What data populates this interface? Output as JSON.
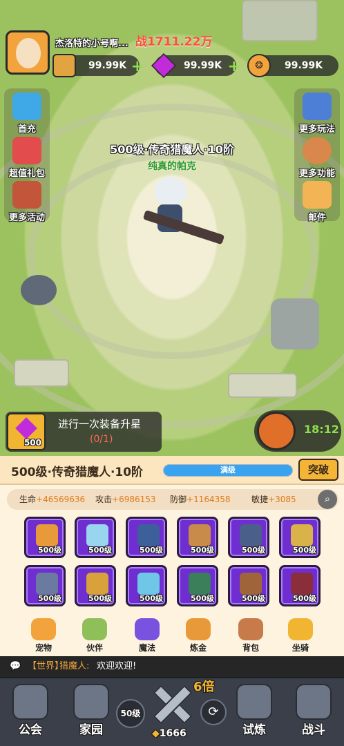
{
  "player": {
    "name": "杰洛特的小号啊...",
    "power": "战1711.22万"
  },
  "resources": [
    {
      "value": "99.99K"
    },
    {
      "value": "99.99K"
    },
    {
      "value": "99.99K"
    }
  ],
  "left_menu": [
    {
      "label": "首充"
    },
    {
      "label": "超值礼包"
    },
    {
      "label": "更多活动"
    }
  ],
  "right_menu": [
    {
      "label": "更多玩法"
    },
    {
      "label": "更多功能"
    },
    {
      "label": "邮件"
    }
  ],
  "hero": {
    "rank": "500级·传奇猎魔人·10阶",
    "name": "纯真的帕克"
  },
  "quest": {
    "reward": "500",
    "title": "进行一次装备升星",
    "progress": "(0/1)"
  },
  "timer": "18:12",
  "level_bar": {
    "title": "500级·传奇猎魔人·10阶",
    "status": "满级",
    "break_label": "突破",
    "fill_fraction": 1.0
  },
  "stats": {
    "hp_label": "生命",
    "hp": "+46569636",
    "atk_label": "攻击",
    "atk": "+6986153",
    "def_label": "防御",
    "def": "+1164358",
    "agi_label": "敏捷",
    "agi": "+3085"
  },
  "equipment": [
    {
      "level": "500级",
      "icon": "sword-icon"
    },
    {
      "level": "500级",
      "icon": "ice-crystal-icon"
    },
    {
      "level": "500级",
      "icon": "armor-icon"
    },
    {
      "level": "500级",
      "icon": "boots-icon"
    },
    {
      "level": "500级",
      "icon": "belt-icon"
    },
    {
      "level": "500级",
      "icon": "helmet-icon"
    },
    {
      "level": "500级",
      "icon": "ring-icon"
    },
    {
      "level": "500级",
      "icon": "shoulder-icon"
    },
    {
      "level": "500级",
      "icon": "gem-icon"
    },
    {
      "level": "500级",
      "icon": "amulet-icon"
    },
    {
      "level": "500级",
      "icon": "bracer-icon"
    },
    {
      "level": "500级",
      "icon": "cape-icon"
    }
  ],
  "functions": [
    {
      "label": "宠物"
    },
    {
      "label": "伙伴"
    },
    {
      "label": "魔法"
    },
    {
      "label": "炼金"
    },
    {
      "label": "背包"
    },
    {
      "label": "坐骑"
    }
  ],
  "chat": {
    "channel": "【世界】",
    "speaker": "猎魔人:",
    "message": "欢迎欢迎!"
  },
  "nav": {
    "guild": "公会",
    "home": "家园",
    "trial": "试炼",
    "battle": "战斗",
    "level": "50级",
    "multiplier": "6倍",
    "cheese": "1666"
  },
  "colors": {
    "accent": "#f2b531",
    "purple": "#6e2ed0",
    "green": "#8de04a"
  }
}
